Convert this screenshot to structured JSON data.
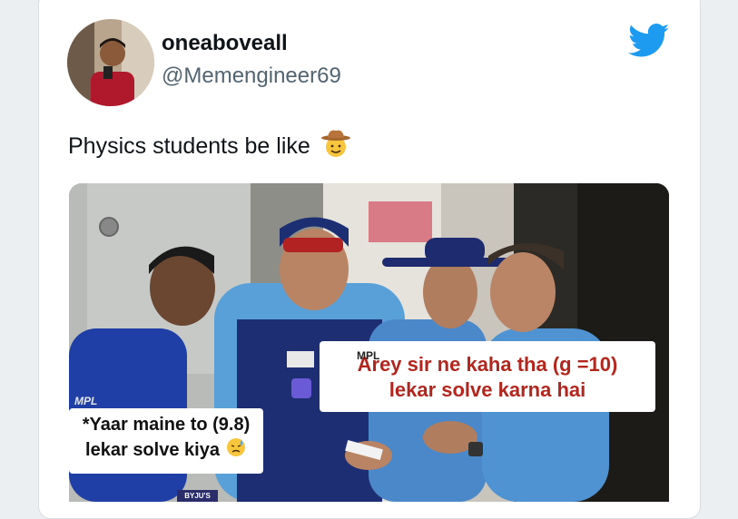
{
  "tweet": {
    "display_name": "oneaboveall",
    "handle": "@Memengineer69",
    "text": "Physics students be like"
  },
  "icons": {
    "brand": "twitter-bird-icon",
    "emoji_text": "cowboy-hat-face-icon",
    "emoji_caption": "downcast-sweat-face-icon"
  },
  "media": {
    "caption_right_line1": "Arey sir ne kaha tha (g =10)",
    "caption_right_line2": "lekar solve karna hai",
    "caption_left_line1": "*Yaar maine to (9.8)",
    "caption_left_line2": "lekar solve kiya",
    "jersey_text": "MPL",
    "jersey_text_2": "MPL",
    "watermark": "BYJU'S"
  },
  "colors": {
    "twitter_blue": "#1d9bf0",
    "caption_red": "#b3261e",
    "jersey_blue": "#1f3fa6"
  }
}
